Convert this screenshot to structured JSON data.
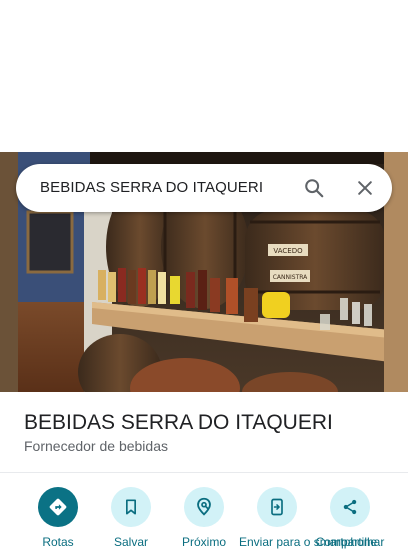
{
  "search": {
    "query": "BEBIDAS SERRA DO ITAQUERI"
  },
  "place": {
    "title": "BEBIDAS SERRA DO ITAQUERI",
    "category": "Fornecedor de bebidas"
  },
  "photo": {
    "barrel_sign_1": "VACEDO",
    "barrel_sign_2": "CANNISTRA"
  },
  "actions": [
    {
      "label": "Rotas",
      "icon": "directions-icon"
    },
    {
      "label": "Salvar",
      "icon": "bookmark-icon"
    },
    {
      "label": "Próximo",
      "icon": "nearby-icon"
    },
    {
      "label": "Enviar para o smartphone",
      "icon": "send-to-phone-icon"
    },
    {
      "label": "Compartilhar",
      "icon": "share-icon"
    }
  ],
  "colors": {
    "accent": "#0b7285",
    "action_bg": "#d2f2f7",
    "label": "#0b6e80"
  }
}
